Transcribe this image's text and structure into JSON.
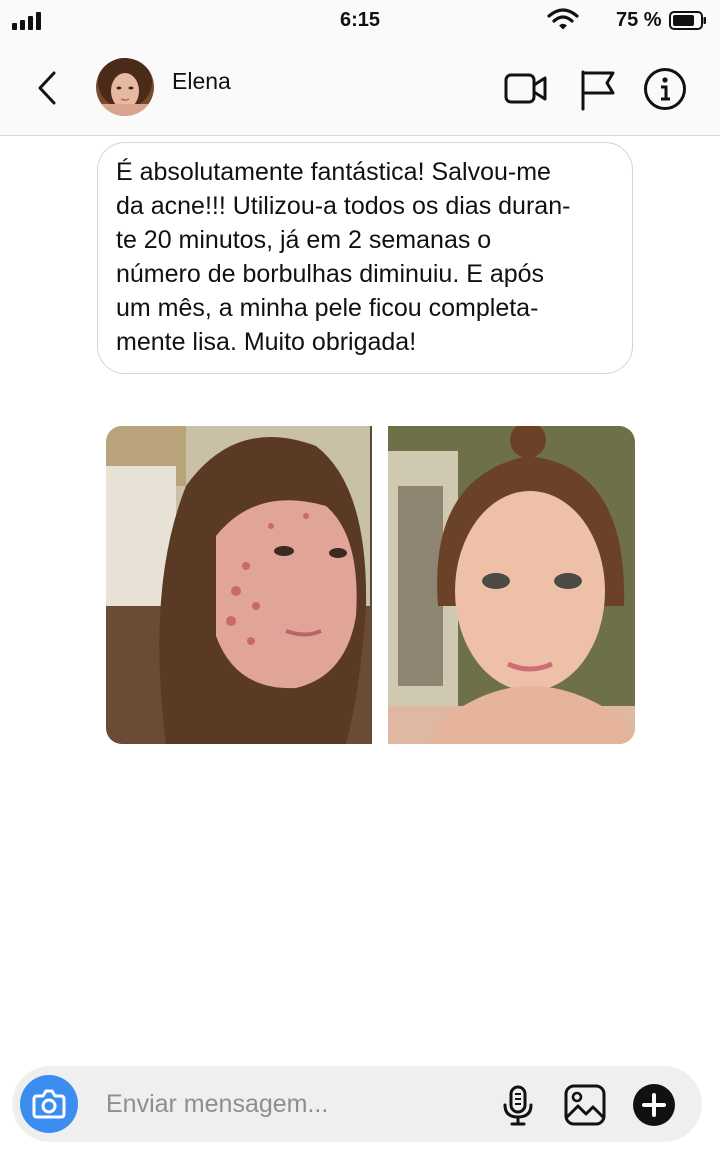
{
  "status": {
    "time": "6:15",
    "battery": "75 %"
  },
  "contact": {
    "name": "Elena"
  },
  "message": {
    "lines": [
      "É absolutamente fantástica! Salvou-me",
      "da acne!!! Utilizou-a todos os dias duran-",
      "te 20 minutos, já em 2 semanas o",
      "número de borbulhas diminuiu. E após",
      "um mês, a minha pele ficou completa-",
      "mente lisa. Muito obrigada!"
    ]
  },
  "composer": {
    "placeholder": "Enviar mensagem..."
  },
  "icons": {
    "signal": "signal-icon",
    "wifi": "wifi-icon",
    "battery": "battery-icon",
    "back": "back-chevron-icon",
    "video": "video-call-icon",
    "flag": "flag-icon",
    "info": "info-icon",
    "camera": "camera-icon",
    "mic": "microphone-icon",
    "gallery": "image-icon",
    "plus": "plus-icon"
  },
  "colors": {
    "accent": "#3b8ef0",
    "text": "#111111",
    "placeholder": "#8e8e8e"
  }
}
